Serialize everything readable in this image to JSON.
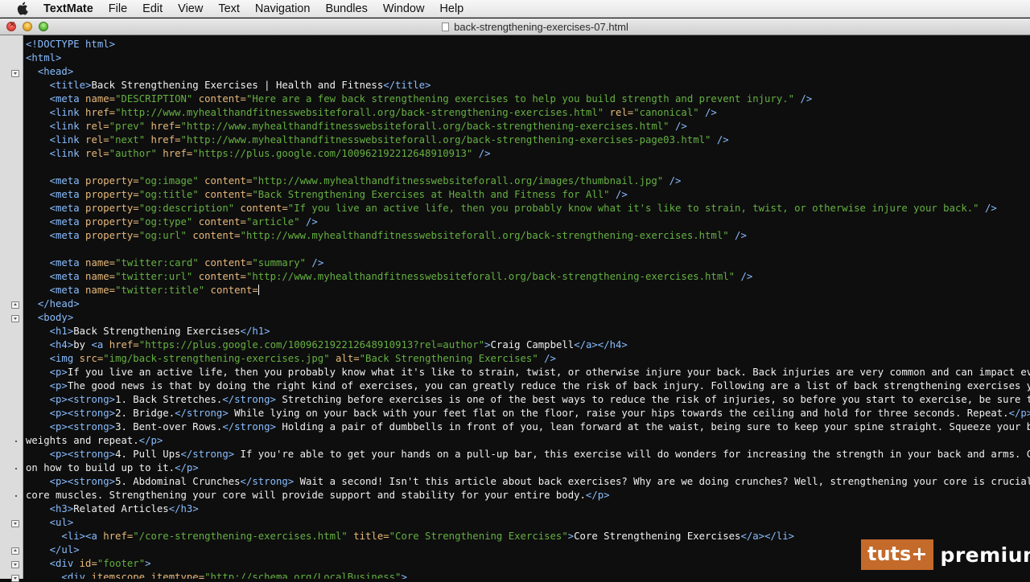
{
  "menubar": {
    "app_name": "TextMate",
    "menus": [
      "File",
      "Edit",
      "View",
      "Text",
      "Navigation",
      "Bundles",
      "Window",
      "Help"
    ]
  },
  "window": {
    "title": "back-strengthening-exercises-07.html"
  },
  "editor": {
    "lines": [
      [
        [
          "t",
          "<!DOCTYPE html>"
        ]
      ],
      [
        [
          "t",
          "<html>"
        ]
      ],
      [
        [
          "x",
          "  "
        ],
        [
          "t",
          "<head>"
        ]
      ],
      [
        [
          "x",
          "    "
        ],
        [
          "t",
          "<title>"
        ],
        [
          "x",
          "Back Strengthening Exercises | Health and Fitness"
        ],
        [
          "t",
          "</title>"
        ]
      ],
      [
        [
          "x",
          "    "
        ],
        [
          "t",
          "<meta "
        ],
        [
          "a",
          "name="
        ],
        [
          "v",
          "\"DESCRIPTION\""
        ],
        [
          "a",
          " content="
        ],
        [
          "v",
          "\"Here are a few back strengthening exercises to help you build strength and prevent injury.\""
        ],
        [
          "t",
          " />"
        ]
      ],
      [
        [
          "x",
          "    "
        ],
        [
          "t",
          "<link "
        ],
        [
          "a",
          "href="
        ],
        [
          "v",
          "\"http://www.myhealthandfitnesswebsiteforall.org/back-strengthening-exercises.html\""
        ],
        [
          "a",
          " rel="
        ],
        [
          "v",
          "\"canonical\""
        ],
        [
          "t",
          " />"
        ]
      ],
      [
        [
          "x",
          "    "
        ],
        [
          "t",
          "<link "
        ],
        [
          "a",
          "rel="
        ],
        [
          "v",
          "\"prev\""
        ],
        [
          "a",
          " href="
        ],
        [
          "v",
          "\"http://www.myhealthandfitnesswebsiteforall.org/back-strengthening-exercises.html\""
        ],
        [
          "t",
          " />"
        ]
      ],
      [
        [
          "x",
          "    "
        ],
        [
          "t",
          "<link "
        ],
        [
          "a",
          "rel="
        ],
        [
          "v",
          "\"next\""
        ],
        [
          "a",
          " href="
        ],
        [
          "v",
          "\"http://www.myhealthandfitnesswebsiteforall.org/back-strengthening-exercises-page03.html\""
        ],
        [
          "t",
          " />"
        ]
      ],
      [
        [
          "x",
          "    "
        ],
        [
          "t",
          "<link "
        ],
        [
          "a",
          "rel="
        ],
        [
          "v",
          "\"author\""
        ],
        [
          "a",
          " href="
        ],
        [
          "v",
          "\"https://plus.google.com/100962192212648910913\""
        ],
        [
          "t",
          " />"
        ]
      ],
      [
        [
          "x",
          ""
        ]
      ],
      [
        [
          "x",
          "    "
        ],
        [
          "t",
          "<meta "
        ],
        [
          "a",
          "property="
        ],
        [
          "v",
          "\"og:image\""
        ],
        [
          "a",
          " content="
        ],
        [
          "v",
          "\"http://www.myhealthandfitnesswebsiteforall.org/images/thumbnail.jpg\""
        ],
        [
          "t",
          " />"
        ]
      ],
      [
        [
          "x",
          "    "
        ],
        [
          "t",
          "<meta "
        ],
        [
          "a",
          "property="
        ],
        [
          "v",
          "\"og:title\""
        ],
        [
          "a",
          " content="
        ],
        [
          "v",
          "\"Back Strengthening Exercises at Health and Fitness for All\""
        ],
        [
          "t",
          " />"
        ]
      ],
      [
        [
          "x",
          "    "
        ],
        [
          "t",
          "<meta "
        ],
        [
          "a",
          "property="
        ],
        [
          "v",
          "\"og:description\""
        ],
        [
          "a",
          " content="
        ],
        [
          "v",
          "\"If you live an active life, then you probably know what it's like to strain, twist, or otherwise injure your back.\""
        ],
        [
          "t",
          " />"
        ]
      ],
      [
        [
          "x",
          "    "
        ],
        [
          "t",
          "<meta "
        ],
        [
          "a",
          "property="
        ],
        [
          "v",
          "\"og:type\""
        ],
        [
          "a",
          " content="
        ],
        [
          "v",
          "\"article\""
        ],
        [
          "t",
          " />"
        ]
      ],
      [
        [
          "x",
          "    "
        ],
        [
          "t",
          "<meta "
        ],
        [
          "a",
          "property="
        ],
        [
          "v",
          "\"og:url\""
        ],
        [
          "a",
          " content="
        ],
        [
          "v",
          "\"http://www.myhealthandfitnesswebsiteforall.org/back-strengthening-exercises.html\""
        ],
        [
          "t",
          " />"
        ]
      ],
      [
        [
          "x",
          ""
        ]
      ],
      [
        [
          "x",
          "    "
        ],
        [
          "t",
          "<meta "
        ],
        [
          "a",
          "name="
        ],
        [
          "v",
          "\"twitter:card\""
        ],
        [
          "a",
          " content="
        ],
        [
          "v",
          "\"summary\""
        ],
        [
          "t",
          " />"
        ]
      ],
      [
        [
          "x",
          "    "
        ],
        [
          "t",
          "<meta "
        ],
        [
          "a",
          "name="
        ],
        [
          "v",
          "\"twitter:url\""
        ],
        [
          "a",
          " content="
        ],
        [
          "v",
          "\"http://www.myhealthandfitnesswebsiteforall.org/back-strengthening-exercises.html\""
        ],
        [
          "t",
          " />"
        ]
      ],
      [
        [
          "x",
          "    "
        ],
        [
          "t",
          "<meta "
        ],
        [
          "a",
          "name="
        ],
        [
          "v",
          "\"twitter:title\""
        ],
        [
          "a",
          " content="
        ],
        [
          "c",
          ""
        ]
      ],
      [
        [
          "x",
          "  "
        ],
        [
          "t",
          "</head>"
        ]
      ],
      [
        [
          "x",
          "  "
        ],
        [
          "t",
          "<body>"
        ]
      ],
      [
        [
          "x",
          "    "
        ],
        [
          "t",
          "<h1>"
        ],
        [
          "x",
          "Back Strengthening Exercises"
        ],
        [
          "t",
          "</h1>"
        ]
      ],
      [
        [
          "x",
          "    "
        ],
        [
          "t",
          "<h4>"
        ],
        [
          "x",
          "by "
        ],
        [
          "t",
          "<a "
        ],
        [
          "a",
          "href="
        ],
        [
          "v",
          "\"https://plus.google.com/100962192212648910913?rel=author\""
        ],
        [
          "t",
          ">"
        ],
        [
          "x",
          "Craig Campbell"
        ],
        [
          "t",
          "</a></h4>"
        ]
      ],
      [
        [
          "x",
          "    "
        ],
        [
          "t",
          "<img "
        ],
        [
          "a",
          "src="
        ],
        [
          "v",
          "\"img/back-strengthening-exercises.jpg\""
        ],
        [
          "a",
          " alt="
        ],
        [
          "v",
          "\"Back Strengthening Exercises\""
        ],
        [
          "t",
          " />"
        ]
      ],
      [
        [
          "x",
          "    "
        ],
        [
          "t",
          "<p>"
        ],
        [
          "x",
          "If you live an active life, then you probably know what it's like to strain, twist, or otherwise injure your back. Back injuries are very common and can impact every a"
        ]
      ],
      [
        [
          "x",
          "    "
        ],
        [
          "t",
          "<p>"
        ],
        [
          "x",
          "The good news is that by doing the right kind of exercises, you can greatly reduce the risk of back injury. Following are a list of back strengthening exercises you ca"
        ]
      ],
      [
        [
          "x",
          "    "
        ],
        [
          "t",
          "<p><strong>"
        ],
        [
          "x",
          "1. Back Stretches."
        ],
        [
          "t",
          "</strong>"
        ],
        [
          "x",
          " Stretching before exercises is one of the best ways to reduce the risk of injuries, so before you start to exercise, be sure to str"
        ]
      ],
      [
        [
          "x",
          "    "
        ],
        [
          "t",
          "<p><strong>"
        ],
        [
          "x",
          "2. Bridge."
        ],
        [
          "t",
          "</strong>"
        ],
        [
          "x",
          " While lying on your back with your feet flat on the floor, raise your hips towards the ceiling and hold for three seconds. Repeat."
        ],
        [
          "t",
          "</p>"
        ]
      ],
      [
        [
          "x",
          "    "
        ],
        [
          "t",
          "<p><strong>"
        ],
        [
          "x",
          "3. Bent-over Rows."
        ],
        [
          "t",
          "</strong>"
        ],
        [
          "x",
          " Holding a pair of dumbbells in front of you, lean forward at the waist, being sure to keep your spine straight. Squeeze your back m"
        ]
      ],
      [
        [
          "x",
          "weights and repeat."
        ],
        [
          "t",
          "</p>"
        ]
      ],
      [
        [
          "x",
          "    "
        ],
        [
          "t",
          "<p><strong>"
        ],
        [
          "x",
          "4. Pull Ups"
        ],
        [
          "t",
          "</strong>"
        ],
        [
          "x",
          " If you're able to get your hands on a pull-up bar, this exercise will do wonders for increasing the strength in your back and arms. Can't"
        ]
      ],
      [
        [
          "x",
          "on how to build up to it."
        ],
        [
          "t",
          "</p>"
        ]
      ],
      [
        [
          "x",
          "    "
        ],
        [
          "t",
          "<p><strong>"
        ],
        [
          "x",
          "5. Abdominal Crunches"
        ],
        [
          "t",
          "</strong>"
        ],
        [
          "x",
          " Wait a second! Isn't this article about back exercises? Why are we doing crunches? Well, strengthening your core is crucial for"
        ]
      ],
      [
        [
          "x",
          "core muscles. Strengthening your core will provide support and stability for your entire body."
        ],
        [
          "t",
          "</p>"
        ]
      ],
      [
        [
          "x",
          "    "
        ],
        [
          "t",
          "<h3>"
        ],
        [
          "x",
          "Related Articles"
        ],
        [
          "t",
          "</h3>"
        ]
      ],
      [
        [
          "x",
          "    "
        ],
        [
          "t",
          "<ul>"
        ]
      ],
      [
        [
          "x",
          "      "
        ],
        [
          "t",
          "<li><a "
        ],
        [
          "a",
          "href="
        ],
        [
          "v",
          "\"/core-strengthening-exercises.html\""
        ],
        [
          "a",
          " title="
        ],
        [
          "v",
          "\"Core Strengthening Exercises\""
        ],
        [
          "t",
          ">"
        ],
        [
          "x",
          "Core Strengthening Exercises"
        ],
        [
          "t",
          "</a></li>"
        ]
      ],
      [
        [
          "x",
          "    "
        ],
        [
          "t",
          "</ul>"
        ]
      ],
      [
        [
          "x",
          "    "
        ],
        [
          "t",
          "<div "
        ],
        [
          "a",
          "id="
        ],
        [
          "v",
          "\"footer\""
        ],
        [
          "t",
          ">"
        ]
      ],
      [
        [
          "x",
          "      "
        ],
        [
          "t",
          "<div "
        ],
        [
          "a",
          "itemscope itemtype="
        ],
        [
          "v",
          "\"http://schema.org/LocalBusiness\""
        ],
        [
          "t",
          ">"
        ]
      ]
    ]
  },
  "watermark": {
    "badge": "tuts+",
    "word": "premium"
  }
}
